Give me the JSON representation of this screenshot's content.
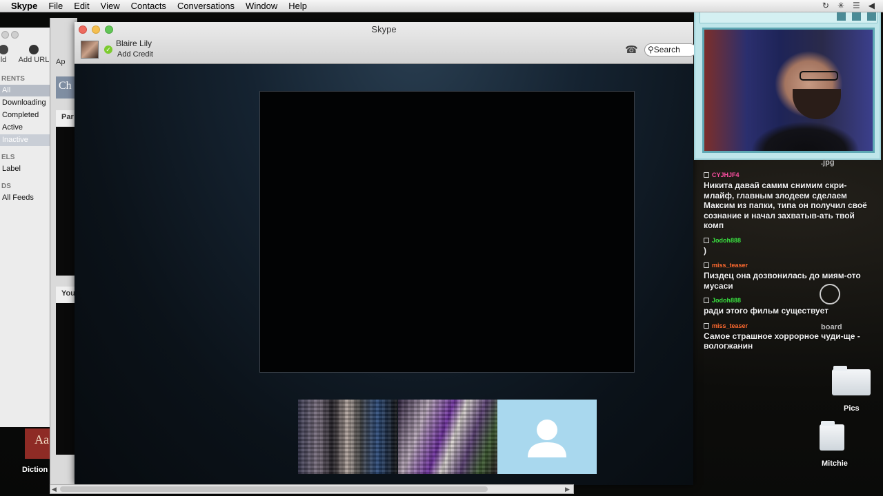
{
  "menubar": {
    "app": "Skype",
    "items": [
      "File",
      "Edit",
      "View",
      "Contacts",
      "Conversations",
      "Window",
      "Help"
    ]
  },
  "torrent": {
    "toolbar": {
      "left_label": "ld",
      "add_url": "Add URL"
    },
    "section_torrents": "RENTS",
    "filters": [
      "All",
      "Downloading",
      "Completed",
      "Active",
      "Inactive"
    ],
    "section_labels": "ELS",
    "label_item": "Label",
    "section_feeds": "DS",
    "feeds_item": "All Feeds"
  },
  "midwin": {
    "tab_text": "Ch",
    "pane1_label": "Par",
    "pane2_label": "You",
    "apps_label": "Ap"
  },
  "skype": {
    "window_title": "Skype",
    "contact_name": "Blaire Lily",
    "credit_link": "Add Credit",
    "search_label": "Search"
  },
  "chat": {
    "messages": [
      {
        "user": "CYJHJF4",
        "color": "#ff4fa3",
        "text": "Никита давай самим снимим скри-млайф, главным злодеем сделаем Максим из папки, типа он получил своё сознание и начал захватыв-ать твой комп"
      },
      {
        "user": "Jodoh888",
        "color": "#39e040",
        "text": ")"
      },
      {
        "user": "miss_teaser",
        "color": "#ff6a2f",
        "text": "Пиздец она дозвонилась до миям-ото мусаси"
      },
      {
        "user": "Jodoh888",
        "color": "#39e040",
        "text": "ради этого фильм существует"
      },
      {
        "user": "miss_teaser",
        "color": "#ff6a2f",
        "text": "Самое страшное хоррорное чуди-ще - вологжанин"
      }
    ]
  },
  "desktop": {
    "jpg_label": ".jpg",
    "board_label": "board",
    "pics_label": "Pics",
    "mitchie_label": "Mitchie",
    "dictionary_label": "Diction",
    "dictionary_glyph": "Aa"
  },
  "cam": {
    "controls": [
      "square-1",
      "square-2",
      "square-3"
    ]
  }
}
